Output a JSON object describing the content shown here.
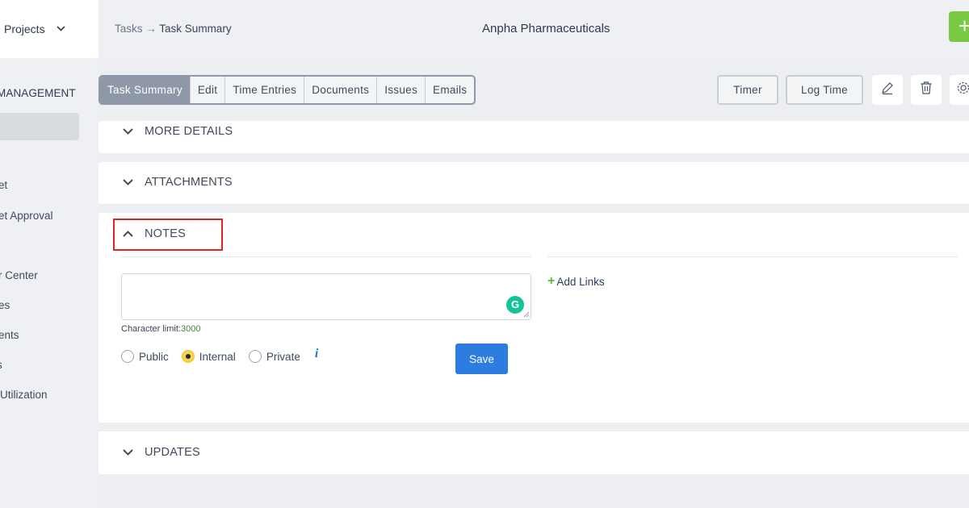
{
  "sidebar": {
    "projects_label": "Projects",
    "section_title": "MANAGEMENT",
    "items": [
      "et",
      "et Approval",
      "r Center",
      "es",
      "ents",
      "s",
      " Utilization"
    ]
  },
  "header": {
    "breadcrumb_parent": "Tasks",
    "breadcrumb_sep": "→",
    "breadcrumb_current": "Task Summary",
    "company": "Anpha Pharmaceuticals",
    "add_label": "+"
  },
  "tabs": [
    "Task Summary",
    "Edit",
    "Time Entries",
    "Documents",
    "Issues",
    "Emails"
  ],
  "toolbar": {
    "timer_label": "Timer",
    "log_time_label": "Log Time"
  },
  "sections": {
    "more_details": "MORE DETAILS",
    "attachments": "ATTACHMENTS",
    "notes": "NOTES",
    "updates": "UPDATES"
  },
  "notes": {
    "textarea_value": "",
    "char_limit_label": "Character limit:",
    "char_limit_value": "3000",
    "visibility_options": [
      "Public",
      "Internal",
      "Private"
    ],
    "selected_visibility": "Internal",
    "info_glyph": "i",
    "save_label": "Save",
    "add_links_label": "Add Links"
  },
  "colors": {
    "accent_blue": "#2d7de0",
    "add_green": "#7ac943",
    "highlight_red": "#e02424",
    "active_tab": "#8e98a8"
  }
}
